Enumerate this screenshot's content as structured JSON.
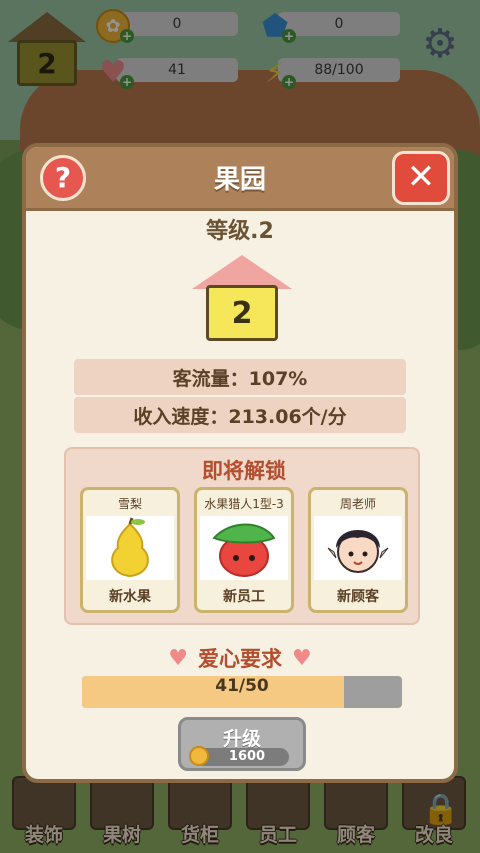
{
  "hud": {
    "level": "2",
    "coins": "0",
    "gems": "0",
    "hearts": "41",
    "energy": "88/100",
    "icons": {
      "coins": "coin-icon",
      "gems": "gem-icon",
      "hearts": "heart-icon",
      "energy": "lightning-icon",
      "settings": "gear-icon"
    }
  },
  "modal": {
    "title": "果园",
    "level_text": "等级.2",
    "house_level": "2",
    "traffic": "客流量：107%",
    "income": "收入速度：213.06个/分",
    "unlock_title": "即将解锁",
    "unlocks": [
      {
        "name": "雪梨",
        "type": "新水果",
        "icon": "pear-icon"
      },
      {
        "name": "水果猎人1型-3",
        "type": "新员工",
        "icon": "apple-hunter-icon"
      },
      {
        "name": "周老师",
        "type": "新顾客",
        "icon": "customer-icon"
      }
    ],
    "heart_req_title": "爱心要求",
    "progress": {
      "current": 41,
      "total": 50,
      "text": "41/50"
    },
    "upgrade_label": "升级",
    "upgrade_cost": "1600"
  },
  "nav": [
    {
      "label": "装饰",
      "icon": "decor-icon"
    },
    {
      "label": "果树",
      "icon": "tree-icon"
    },
    {
      "label": "货柜",
      "icon": "counter-icon"
    },
    {
      "label": "员工",
      "icon": "staff-icon"
    },
    {
      "label": "顾客",
      "icon": "customer-icon"
    },
    {
      "label": "改良",
      "icon": "lock-icon"
    }
  ],
  "colors": {
    "modal_bg": "#f6f1e3",
    "header": "#ad825a",
    "close": "#e04b3c",
    "accent_red": "#b34f2f",
    "progress_fill": "#f5c982"
  }
}
